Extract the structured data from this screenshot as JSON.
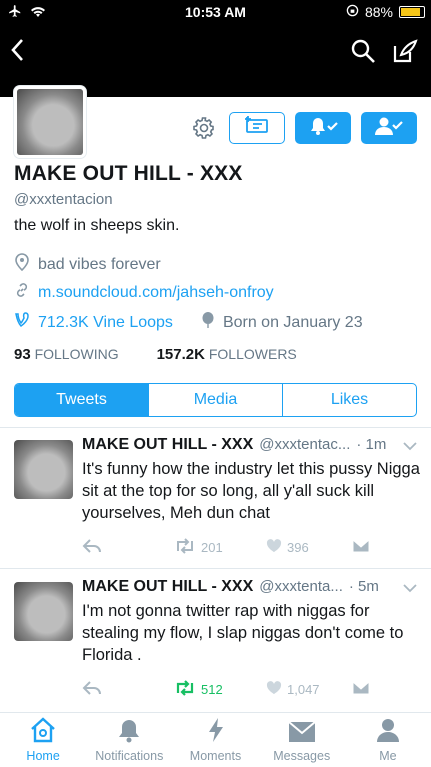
{
  "status_bar": {
    "time": "10:53 AM",
    "battery": "88%",
    "battery_level": 0.88
  },
  "profile": {
    "name": "MAKE OUT HILL - XXX",
    "handle": "@xxxtentacion",
    "bio": "the wolf in sheeps skin.",
    "location": "bad vibes forever",
    "website": "m.soundcloud.com/jahseh-onfroy",
    "vine_loops": "712.3K Vine Loops",
    "birthday": "Born on January 23",
    "following_count": "93",
    "following_label": "FOLLOWING",
    "followers_count": "157.2K",
    "followers_label": "FOLLOWERS"
  },
  "tabs": [
    "Tweets",
    "Media",
    "Likes"
  ],
  "tweets": [
    {
      "name": "MAKE OUT HILL - XXX",
      "handle": "@xxxtentac...",
      "time": "· 1m",
      "text": "It's funny how the industry let this pussy Nigga sit at the top for so long, all y'all suck kill yourselves, Meh dun chat",
      "retweets": "201",
      "likes": "396"
    },
    {
      "name": "MAKE OUT HILL - XXX",
      "handle": "@xxxtenta...",
      "time": "· 5m",
      "text": "I'm not gonna twitter rap with niggas for stealing my flow, I slap niggas don't come to Florida .",
      "retweets": "512",
      "likes": "1,047"
    }
  ],
  "tab_bar": [
    "Home",
    "Notifications",
    "Moments",
    "Messages",
    "Me"
  ],
  "colors": {
    "accent": "#1da1f2",
    "retweet_active": "#17bf63",
    "muted": "#657786"
  }
}
